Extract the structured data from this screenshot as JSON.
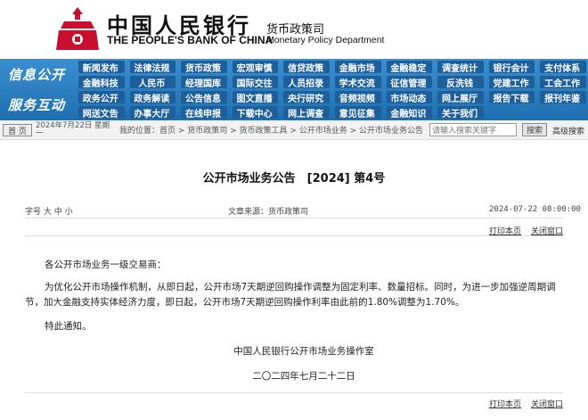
{
  "header": {
    "bank_cn": "中国人民银行",
    "bank_en": "THE PEOPLE'S BANK OF CHINA",
    "dept_cn": "货币政策司",
    "dept_en": "Monetary Policy Department"
  },
  "nav": {
    "label_info": "信息公开",
    "label_service": "服务互动",
    "rows": [
      [
        "新闻发布",
        "法律法规",
        "货币政策",
        "宏观审慎",
        "信贷政策",
        "金融市场",
        "金融稳定",
        "调查统计",
        "银行会计",
        "支付体系"
      ],
      [
        "金融科技",
        "人民币",
        "经理国库",
        "国际交往",
        "人员招录",
        "学术交流",
        "征信管理",
        "反洗钱",
        "党建工作",
        "工会工作"
      ],
      [
        "政务公开",
        "政务解读",
        "公告信息",
        "图文直播",
        "央行研究",
        "音频视频",
        "市场动态",
        "网上展厅",
        "报告下载",
        "报刊年鉴"
      ],
      [
        "网送文告",
        "办事大厅",
        "在线申报",
        "下载中心",
        "网上调查",
        "意见征集",
        "金融知识",
        "关于我们"
      ]
    ]
  },
  "crumbbar": {
    "home": "首 页",
    "date": "2024年7月22日 星期一",
    "path": "我的位置：首页  >  货币政策司  >  货币政策工具  >  公开市场业务  >  公开市场业务公告",
    "search_placeholder": "请输入搜索关键字",
    "search_btn": "搜索",
    "advanced": "高级搜索"
  },
  "article": {
    "title": "公开市场业务公告　[2024] 第4号",
    "font_size_label": "字号 大 中 小",
    "source": "文章来源：货币政策司",
    "time": "2024-07-22 08:00:00",
    "print": "打印本页",
    "close": "关闭窗口",
    "greeting": "各公开市场业务一级交易商：",
    "paragraph": "为优化公开市场操作机制，从即日起，公开市场7天期逆回购操作调整为固定利率、数量招标。同时，为进一步加强逆周期调节，加大金融支持实体经济力度，即日起，公开市场7天期逆回购操作利率由此前的1.80%调整为1.70%。",
    "notice": "特此通知。",
    "signature_org": "中国人民银行公开市场业务操作室",
    "signature_date": "二〇二四年七月二十二日"
  },
  "colors": {
    "nav_blue": "#2b7fc0",
    "emblem_red": "#c8102e"
  }
}
